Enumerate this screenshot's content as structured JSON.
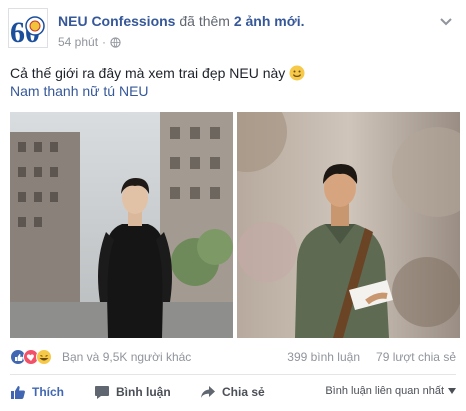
{
  "post": {
    "page_name": "NEU Confessions",
    "action": "đã thêm",
    "new_photos": "2 ảnh mới.",
    "time": "54 phút",
    "separator": "·",
    "text": "Cả thế giới ra đây mà xem trai đẹp NEU này",
    "hashtag": "Nam thanh nữ tú NEU",
    "avatar_number": "60"
  },
  "stats": {
    "reactions_text": "Bạn và 9,5K người khác",
    "comments": "399 bình luận",
    "shares": "79 lượt chia sẻ"
  },
  "actions": {
    "like": "Thích",
    "comment": "Bình luận",
    "share": "Chia sẻ",
    "sort": "Bình luận liên quan nhất"
  },
  "icons": {
    "privacy": "globe-icon",
    "menu": "chevron-down-icon",
    "like": "thumbs-up-icon",
    "comment": "speech-bubble-icon",
    "share": "share-arrow-icon"
  },
  "colors": {
    "link": "#365899",
    "like_blue": "#4267b2",
    "muted": "#90949c"
  }
}
